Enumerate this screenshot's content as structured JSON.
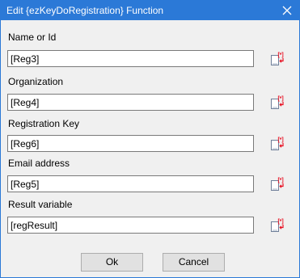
{
  "window": {
    "title": "Edit {ezKeyDoRegistration} Function"
  },
  "fields": [
    {
      "label": "Name or Id",
      "value": "[Reg3]"
    },
    {
      "label": "Organization",
      "value": "[Reg4]"
    },
    {
      "label": "Registration Key",
      "value": "[Reg6]"
    },
    {
      "label": "Email address",
      "value": "[Reg5]"
    },
    {
      "label": "Result variable",
      "value": "[regResult]"
    }
  ],
  "buttons": {
    "ok_label": "Ok",
    "cancel_label": "Cancel"
  },
  "icons": {
    "close": "close-icon",
    "variable_picker": "insert-variable-icon"
  },
  "colors": {
    "titlebar": "#2b79d7",
    "dialog_background": "#f0f0f0",
    "picker_marker": "#e81123"
  }
}
